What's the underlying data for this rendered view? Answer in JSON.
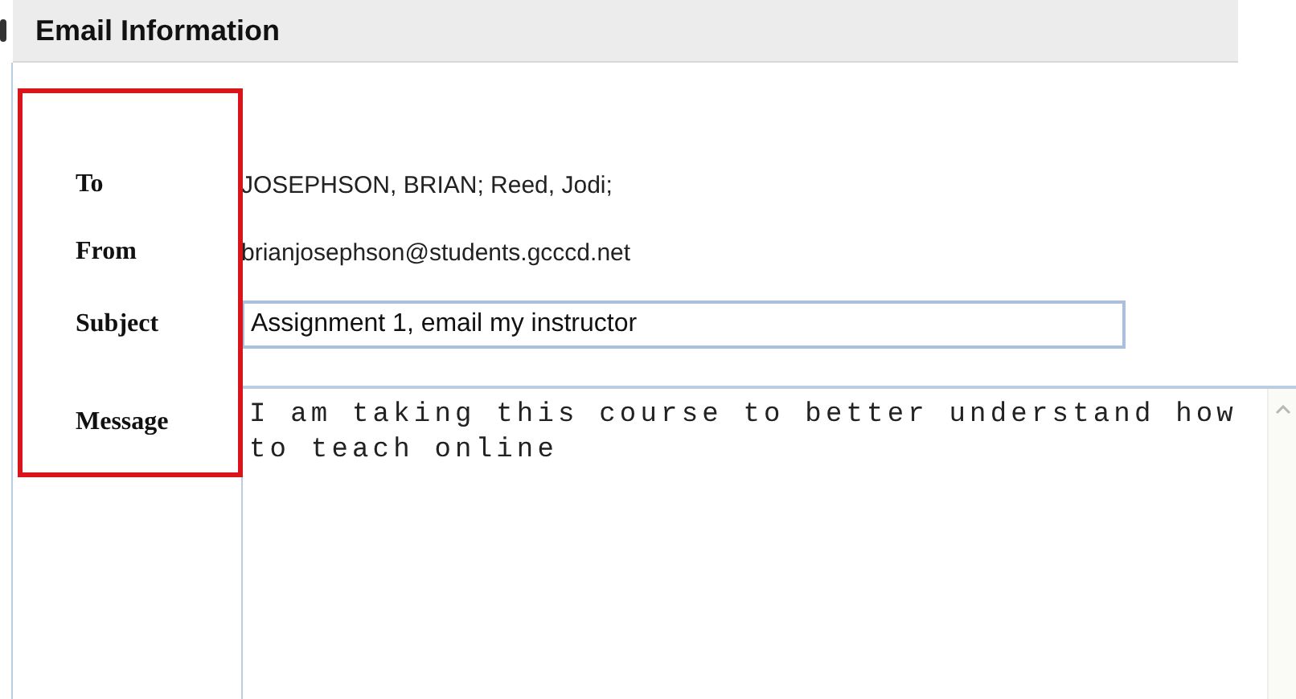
{
  "section": {
    "title": "Email Information"
  },
  "fields": [
    {
      "label": "To",
      "kind": "text",
      "value": "JOSEPHSON, BRIAN; Reed, Jodi;"
    },
    {
      "label": "From",
      "kind": "text",
      "value": "brianjosephson@students.gcccd.net"
    },
    {
      "label": "Subject",
      "kind": "input",
      "value": "Assignment 1, email my instructor"
    },
    {
      "label": "Message",
      "kind": "textarea",
      "value": "I am taking this course to better understand how to teach online"
    }
  ]
}
